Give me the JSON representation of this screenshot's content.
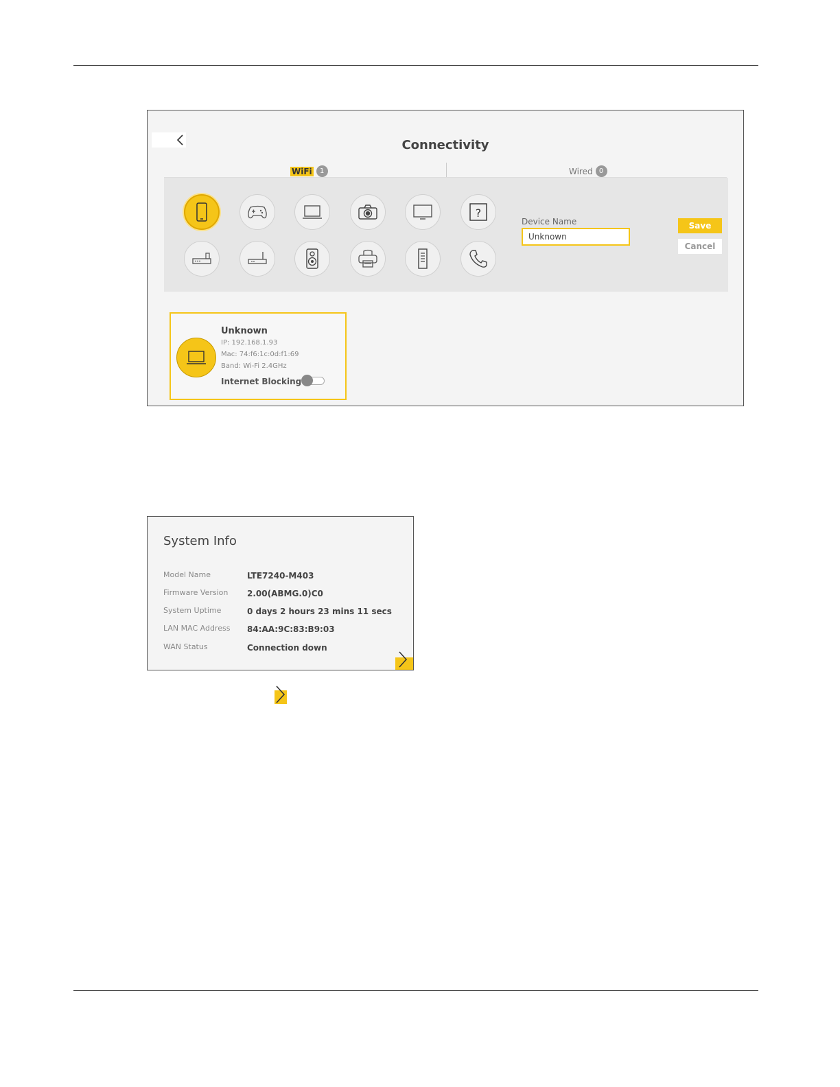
{
  "connectivity": {
    "title": "Connectivity",
    "tabs": {
      "wifi": {
        "label": "WiFi",
        "count": "1"
      },
      "wired": {
        "label": "Wired",
        "count": "0"
      }
    },
    "device_types": [
      {
        "icon": "smartphone-icon",
        "selected": true
      },
      {
        "icon": "gamepad-icon",
        "selected": false
      },
      {
        "icon": "laptop-icon",
        "selected": false
      },
      {
        "icon": "camera-icon",
        "selected": false
      },
      {
        "icon": "monitor-icon",
        "selected": false
      },
      {
        "icon": "question-icon",
        "selected": false
      },
      {
        "icon": "router-icon",
        "selected": false
      },
      {
        "icon": "modem-icon",
        "selected": false
      },
      {
        "icon": "speaker-icon",
        "selected": false
      },
      {
        "icon": "printer-icon",
        "selected": false
      },
      {
        "icon": "server-icon",
        "selected": false
      },
      {
        "icon": "phone-icon",
        "selected": false
      }
    ],
    "device_name_label": "Device Name",
    "device_name_value": "Unknown",
    "save_label": "Save",
    "cancel_label": "Cancel",
    "card": {
      "name": "Unknown",
      "ip": "IP: 192.168.1.93",
      "mac": "Mac: 74:f6:1c:0d:f1:69",
      "band": "Band: Wi-Fi 2.4GHz",
      "blocking_label": "Internet Blocking",
      "blocking_enabled": false
    },
    "accent_color": "#f5c518"
  },
  "system_info": {
    "title": "System Info",
    "rows": [
      {
        "label": "Model Name",
        "value": "LTE7240-M403"
      },
      {
        "label": "Firmware Version",
        "value": "2.00(ABMG.0)C0"
      },
      {
        "label": "System Uptime",
        "value": "0 days 2 hours 23 mins 11 secs"
      },
      {
        "label": "LAN MAC Address",
        "value": "84:AA:9C:83:B9:03"
      },
      {
        "label": "WAN Status",
        "value": "Connection down"
      }
    ]
  }
}
